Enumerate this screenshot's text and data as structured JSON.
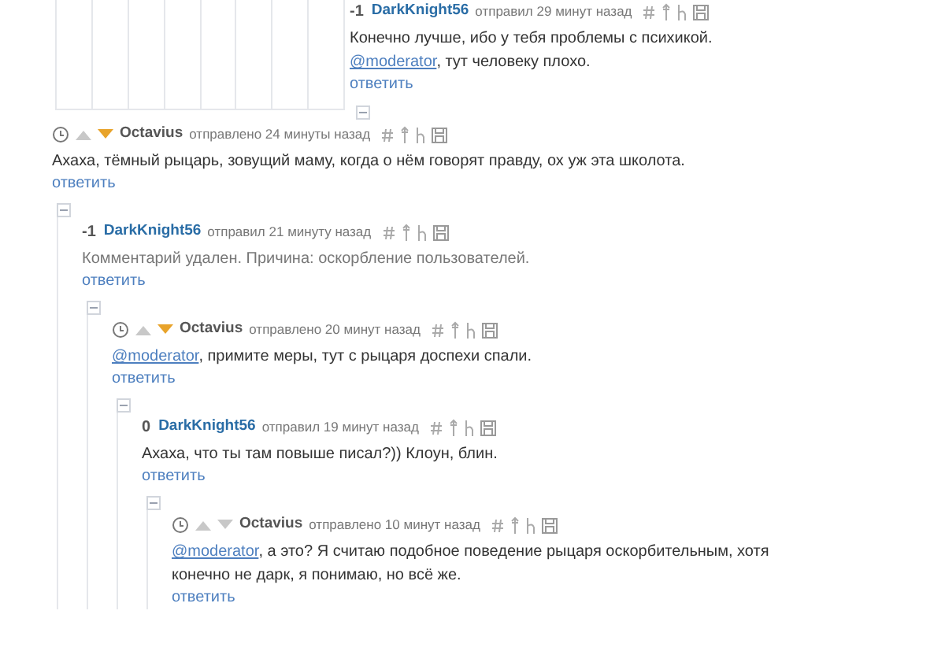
{
  "partial_comment": {
    "score": "-1",
    "author": "DarkKnight56",
    "meta": "отправил 29 минут назад",
    "deleted": false,
    "body": [
      {
        "kind": "text",
        "text": "Конечно лучше, ибо у тебя проблемы с психикой. "
      },
      {
        "kind": "mention",
        "text": "@moderator"
      },
      {
        "kind": "text",
        "text": ", тут человеку плохо."
      }
    ],
    "reply": "ответить"
  },
  "comments": [
    {
      "author": "Octavius",
      "meta": "отправлено 24 минуты назад",
      "downvoted": true,
      "deleted": false,
      "body": [
        {
          "kind": "text",
          "text": "Ахаха, тёмный рыцарь, зовущий маму, когда о нём говорят правду, ох уж эта школота."
        }
      ],
      "reply": "ответить",
      "children": [
        {
          "score": "-1",
          "author": "DarkKnight56",
          "meta": "отправил 21 минуту назад",
          "deleted": true,
          "body": [
            {
              "kind": "text",
              "text": "Комментарий удален. Причина: оскорбление пользователей."
            }
          ],
          "reply": "ответить",
          "children": [
            {
              "author": "Octavius",
              "meta": "отправлено 20 минут назад",
              "downvoted": true,
              "deleted": false,
              "body": [
                {
                  "kind": "mention",
                  "text": "@moderator"
                },
                {
                  "kind": "text",
                  "text": ", примите меры, тут с рыцаря доспехи спали."
                }
              ],
              "reply": "ответить",
              "children": [
                {
                  "score": "0",
                  "author": "DarkKnight56",
                  "meta": "отправил 19 минут назад",
                  "deleted": false,
                  "body": [
                    {
                      "kind": "text",
                      "text": "Ахаха, что ты там повыше писал?)) Клоун, блин."
                    }
                  ],
                  "reply": "ответить",
                  "children": [
                    {
                      "author": "Octavius",
                      "meta": "отправлено 10 минут назад",
                      "downvoted": false,
                      "deleted": false,
                      "body": [
                        {
                          "kind": "mention",
                          "text": "@moderator"
                        },
                        {
                          "kind": "text",
                          "text": ", а это? Я считаю подобное поведение рыцаря оскорбительным, хотя конечно не дарк, я понимаю, но всё же."
                        }
                      ],
                      "reply": "ответить"
                    }
                  ]
                }
              ]
            }
          ]
        }
      ]
    }
  ]
}
